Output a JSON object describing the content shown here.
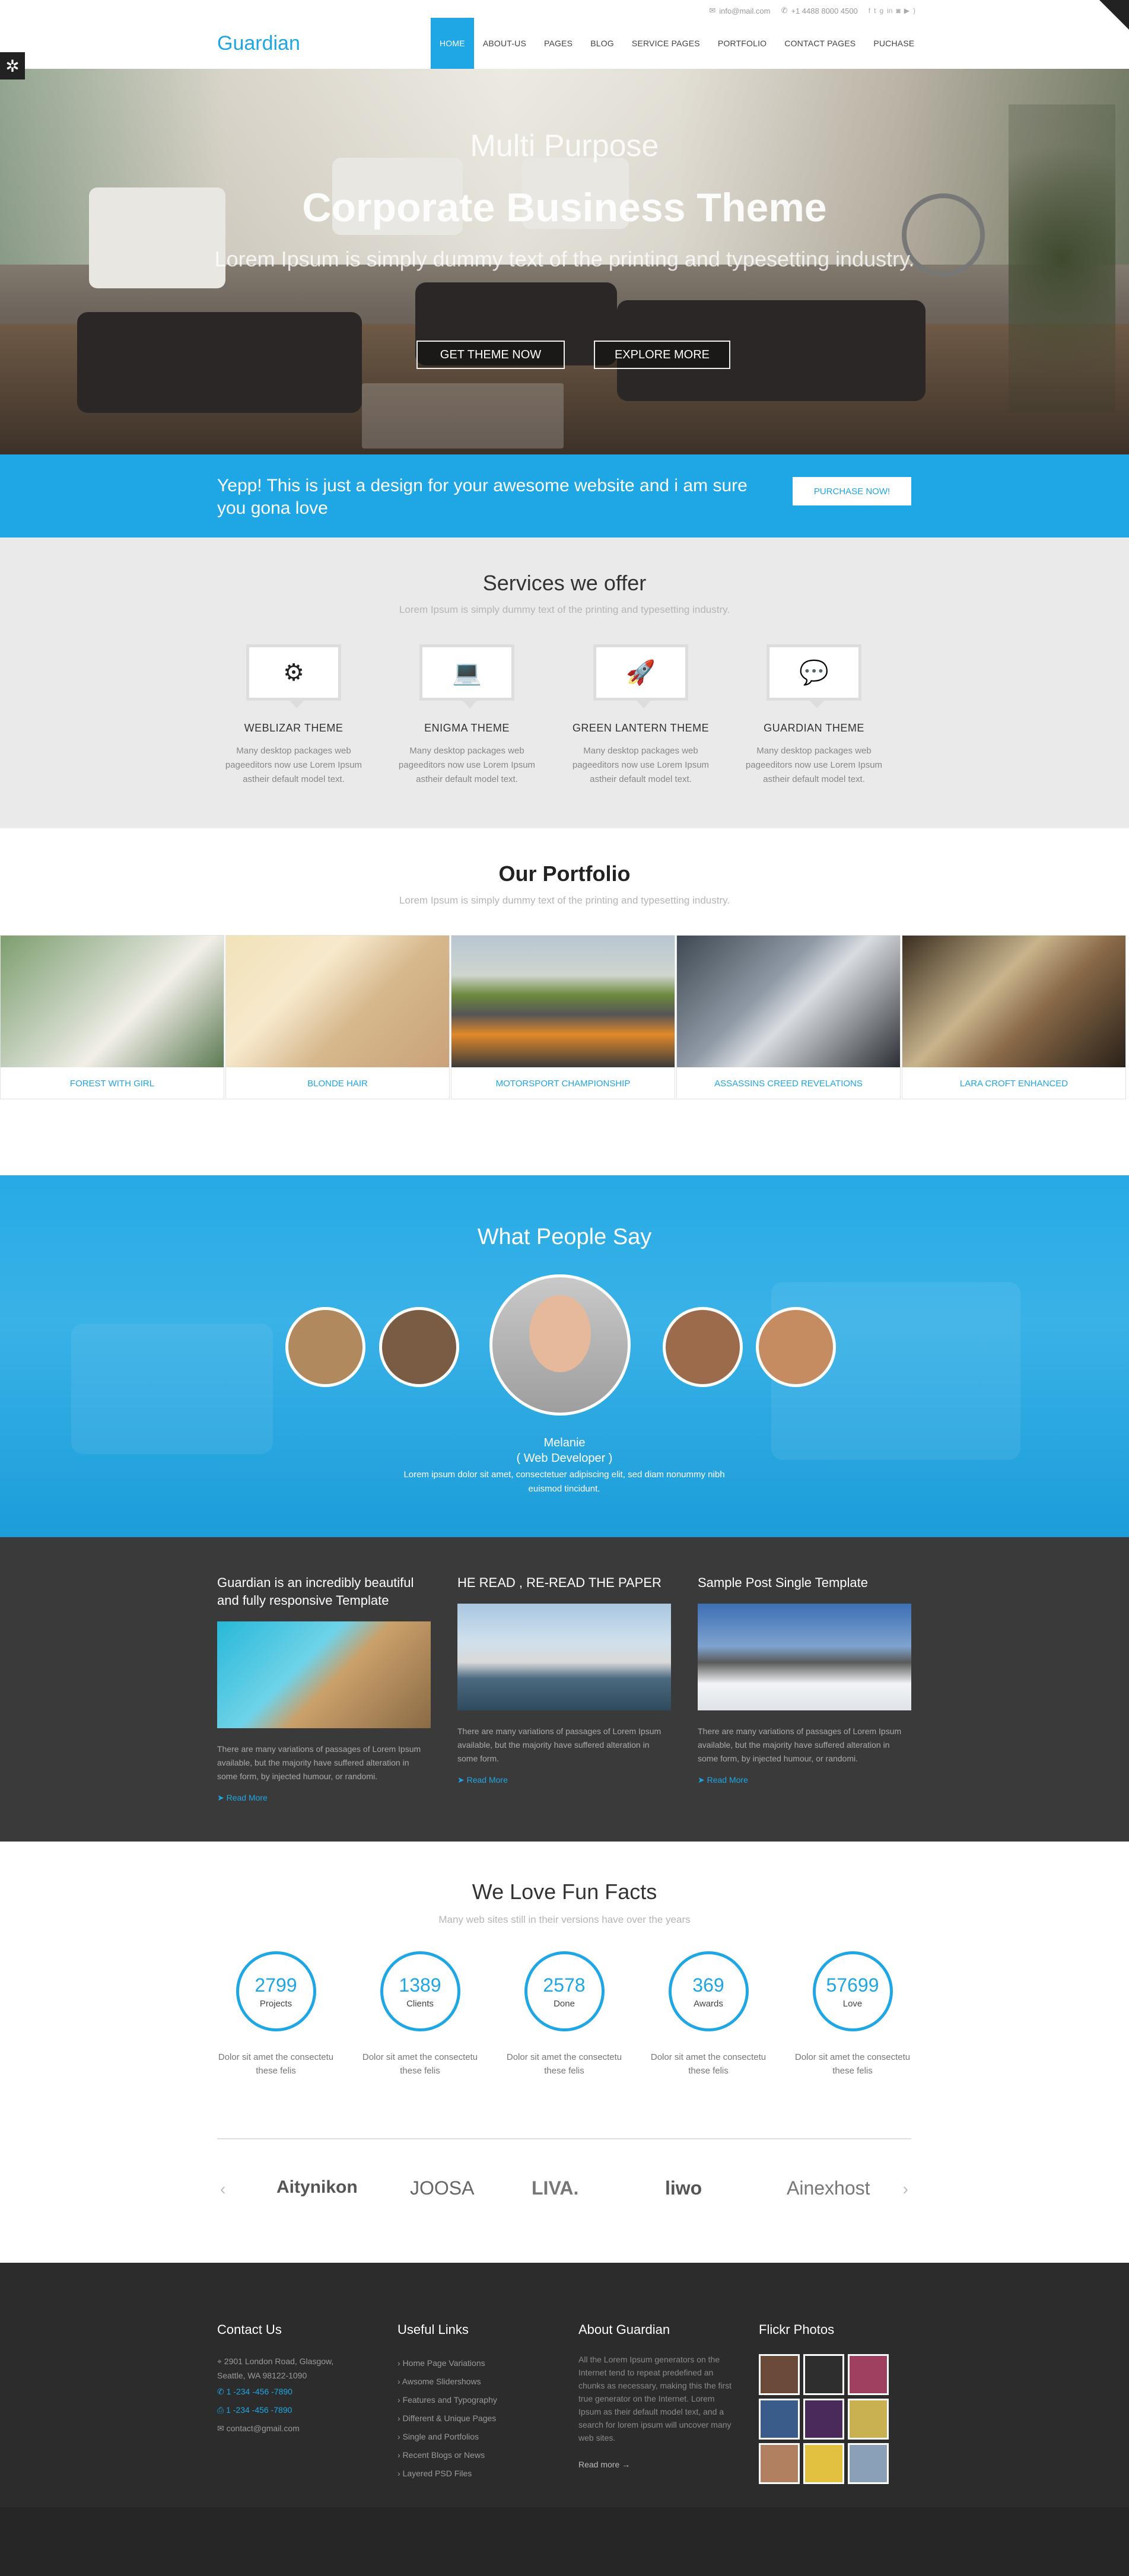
{
  "topbar": {
    "email": "info@mail.com",
    "phone": "+1 4488 8000 4500",
    "social": [
      "facebook-icon",
      "twitter-icon",
      "google-plus-icon",
      "linkedin-icon",
      "instagram-icon",
      "youtube-icon",
      "rss-icon"
    ]
  },
  "header": {
    "logo": "Guardian",
    "nav": [
      "HOME",
      "ABOUT-US",
      "PAGES",
      "BLOG",
      "SERVICE PAGES",
      "PORTFOLIO",
      "CONTACT PAGES",
      "PUCHASE"
    ],
    "active": "HOME"
  },
  "hero": {
    "subtitle": "Multi Purpose",
    "title": "Corporate Business Theme",
    "lead": "Lorem Ipsum is simply dummy text of the printing and typesetting industry.",
    "btn1": "GET THEME NOW",
    "btn2": "EXPLORE MORE"
  },
  "band": {
    "text": "Yepp! This is just a design for your awesome website and i am sure you gona love",
    "button": "PURCHASE NOW!"
  },
  "services": {
    "title": "Services we offer",
    "subtitle": "Lorem Ipsum is simply dummy text of the printing and typesetting industry.",
    "items": [
      {
        "icon": "gear-icon",
        "glyph": "⚙",
        "title": "WEBLIZAR THEME",
        "text": "Many desktop packages web pageeditors now use Lorem Ipsum astheir default model text."
      },
      {
        "icon": "laptop-icon",
        "glyph": "💻",
        "title": "ENIGMA THEME",
        "text": "Many desktop packages web pageeditors now use Lorem Ipsum astheir default model text."
      },
      {
        "icon": "rocket-icon",
        "glyph": "🚀",
        "title": "GREEN LANTERN THEME",
        "text": "Many desktop packages web pageeditors now use Lorem Ipsum astheir default model text."
      },
      {
        "icon": "chat-icon",
        "glyph": "💬",
        "title": "GUARDIAN THEME",
        "text": "Many desktop packages web pageeditors now use Lorem Ipsum astheir default model text."
      }
    ]
  },
  "portfolio": {
    "title": "Our Portfolio",
    "subtitle": "Lorem Ipsum is simply dummy text of the printing and typesetting industry.",
    "items": [
      "FOREST WITH GIRL",
      "BLONDE HAIR",
      "MOTORSPORT CHAMPIONSHIP",
      "ASSASSINS CREED REVELATIONS",
      "LARA CROFT ENHANCED"
    ]
  },
  "testimonials": {
    "title": "What People Say",
    "name": "Melanie",
    "role": "( Web Developer )",
    "quote": "Lorem ipsum dolor sit amet, consectetuer adipiscing elit, sed diam nonummy nibh euismod tincidunt."
  },
  "blog": {
    "posts": [
      {
        "title": "Guardian is an incredibly beautiful and fully responsive Template",
        "text": "There are many variations of passages of Lorem Ipsum available, but the majority have suffered alteration in some form, by injected humour, or randomi.",
        "more": "Read More"
      },
      {
        "title": "HE READ , RE-READ THE PAPER",
        "text": "There are many variations of passages of Lorem Ipsum available, but the majority have suffered alteration in some form.",
        "more": "Read More"
      },
      {
        "title": "Sample Post Single Template",
        "text": "There are many variations of passages of Lorem Ipsum available, but the majority have suffered alteration in some form, by injected humour, or randomi.",
        "more": "Read More"
      }
    ]
  },
  "facts": {
    "title": "We Love Fun Facts",
    "subtitle": "Many web sites still in their versions have over the years",
    "items": [
      {
        "num": "2799",
        "label": "Projects",
        "text": "Dolor sit amet the consectetu these felis"
      },
      {
        "num": "1389",
        "label": "Clients",
        "text": "Dolor sit amet the consectetu these felis"
      },
      {
        "num": "2578",
        "label": "Done",
        "text": "Dolor sit amet the consectetu these felis"
      },
      {
        "num": "369",
        "label": "Awards",
        "text": "Dolor sit amet the consectetu these felis"
      },
      {
        "num": "57699",
        "label": "Love",
        "text": "Dolor sit amet the consectetu these felis"
      }
    ],
    "clients": [
      "Aitynikon",
      "JOOSA",
      "LIVA.",
      "liwo",
      "Ainexhost"
    ]
  },
  "footer": {
    "contact": {
      "title": "Contact Us",
      "address": "2901 London Road, Glasgow, Seattle, WA 98122-1090",
      "phone": "1 -234 -456 -7890",
      "fax": "1 -234 -456 -7890",
      "email": "contact@gmail.com"
    },
    "links": {
      "title": "Useful Links",
      "items": [
        "Home Page Variations",
        "Awsome Slidershows",
        "Features and Typography",
        "Different & Unique Pages",
        "Single and Portfolios",
        "Recent Blogs or News",
        "Layered PSD Files"
      ]
    },
    "about": {
      "title": "About Guardian",
      "text": "All the Lorem Ipsum generators on the Internet tend to repeat predefined an chunks as necessary, making this the first true generator on the Internet. Lorem Ipsum as their default model text, and a search for lorem ipsum will uncover many web sites.",
      "more": "Read more"
    },
    "flickr": {
      "title": "Flickr Photos"
    }
  },
  "colors": {
    "accent": "#1ea7e4",
    "dark": "#3a3a3a",
    "footer": "#2c2c2c"
  }
}
